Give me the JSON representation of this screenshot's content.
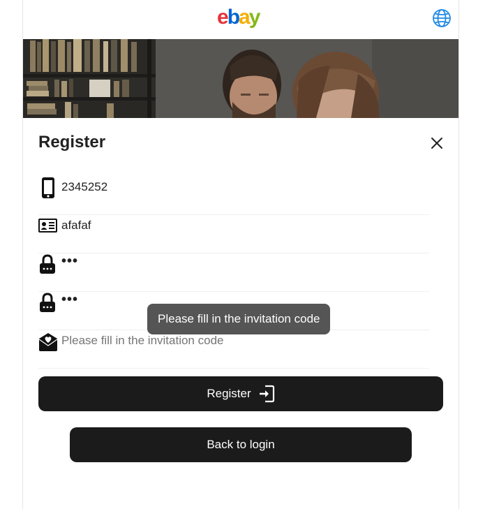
{
  "header": {
    "logo_letters": [
      "e",
      "b",
      "a",
      "y"
    ],
    "logo_colors": [
      "#e53238",
      "#0064d2",
      "#f5af02",
      "#86b817"
    ],
    "language_icon": "globe-icon",
    "accent": "#1e88e5"
  },
  "form": {
    "title": "Register",
    "close_icon": "close-icon",
    "fields": [
      {
        "icon": "phone-icon",
        "value": "2345252"
      },
      {
        "icon": "id-card-icon",
        "value": "afafaf"
      },
      {
        "icon": "lock-icon",
        "value": "•••"
      },
      {
        "icon": "lock-icon",
        "value": "•••"
      },
      {
        "icon": "invite-envelope-icon",
        "placeholder": "Please fill in the invitation code",
        "value": ""
      }
    ],
    "tooltip": "Please fill in the invitation code",
    "register_label": "Register",
    "register_icon": "sign-in-icon",
    "back_label": "Back to login",
    "button_color": "#1b1b1b"
  }
}
